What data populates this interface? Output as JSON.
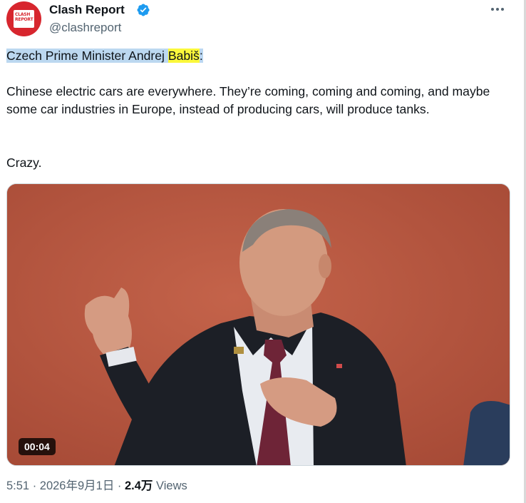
{
  "author": {
    "name": "Clash Report",
    "handle": "@clashreport",
    "avatar_text_line1": "CLASH",
    "avatar_text_line2": "REPORT"
  },
  "icons": {
    "verified": "verified-badge-icon",
    "more": "more-horizontal-icon"
  },
  "colors": {
    "verified_blue": "#1d9bf0",
    "brand_red": "#d7262e",
    "selection_blue": "#bcd8f0",
    "search_highlight": "#fbf83b",
    "muted_text": "#536471"
  },
  "tweet": {
    "line1_before": "Czech Prime Minister Andrej ",
    "line1_highlight": "Babiš",
    "line1_after": ":",
    "paragraph": "Chinese electric cars are everywhere. They’re coming, coming and coming, and maybe some car industries in Europe, instead of producing cars, will produce tanks.",
    "closing": "Crazy."
  },
  "media": {
    "duration": "00:04"
  },
  "meta": {
    "time_date": "5:51 · 2026年9月1日 · ",
    "views_count": "2.4万",
    "views_label": " Views"
  }
}
